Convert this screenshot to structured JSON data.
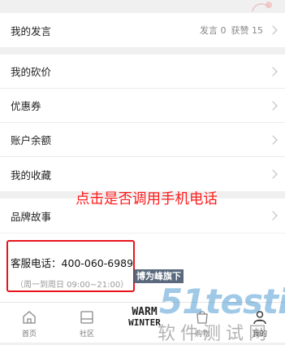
{
  "speech": {
    "label": "我的发言",
    "stats": {
      "posts": "发言 0",
      "likes": "获赞 15"
    }
  },
  "menu": {
    "items": [
      {
        "label": "我的砍价"
      },
      {
        "label": "优惠券"
      },
      {
        "label": "账户余额"
      },
      {
        "label": "我的收藏"
      }
    ]
  },
  "brand_story": {
    "label": "品牌故事"
  },
  "annotation": {
    "text": "点击是否调用手机电话"
  },
  "customer_service": {
    "phone": "客服电话：400-060-6989",
    "hours": "（周一到周日 09:00~21:00）"
  },
  "watermark": {
    "line1": "博为峰旗下",
    "line2": "51testing",
    "line3": "软件测试网"
  },
  "tabbar": {
    "tabs": [
      {
        "label": "首页",
        "icon": "home-icon"
      },
      {
        "label": "社区",
        "icon": "community-icon"
      },
      {
        "label": "",
        "icon": "brand-logo"
      },
      {
        "label": "购物",
        "icon": "shopping-icon"
      },
      {
        "label": "我的",
        "icon": "profile-icon"
      }
    ],
    "brand_text": {
      "line1": "WARM",
      "line2": "WINTER"
    },
    "active_index": 4
  },
  "colors": {
    "annotation_red": "#ff1a1a",
    "highlight_border": "#e8141c",
    "watermark_blue": "#2d88c8"
  }
}
